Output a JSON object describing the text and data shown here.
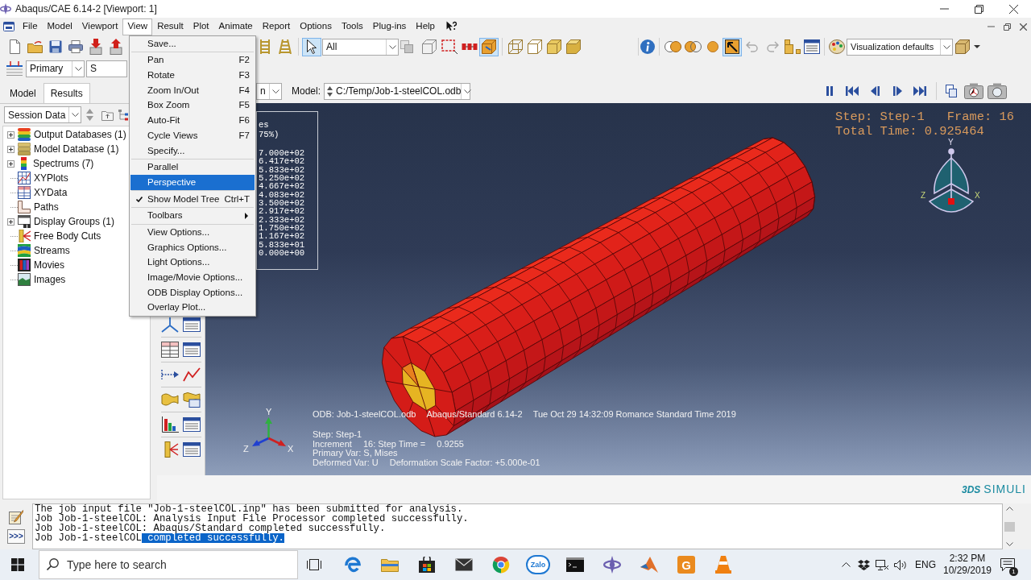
{
  "window": {
    "title": "Abaqus/CAE 6.14-2 [Viewport: 1]"
  },
  "menu_bar": [
    {
      "label": "File",
      "selected": false
    },
    {
      "label": "Model",
      "selected": false
    },
    {
      "label": "Viewport",
      "selected": false
    },
    {
      "label": "View",
      "selected": true
    },
    {
      "label": "Result",
      "selected": false
    },
    {
      "label": "Plot",
      "selected": false
    },
    {
      "label": "Animate",
      "selected": false
    },
    {
      "label": "Report",
      "selected": false
    },
    {
      "label": "Options",
      "selected": false
    },
    {
      "label": "Tools",
      "selected": false
    },
    {
      "label": "Plug-ins",
      "selected": false
    },
    {
      "label": "Help",
      "selected": false
    }
  ],
  "view_menu": [
    {
      "kind": "item",
      "label": "Save...",
      "selected": false,
      "checked": false
    },
    {
      "kind": "separator"
    },
    {
      "kind": "item",
      "label": "Pan",
      "shortcut": "F2",
      "selected": false,
      "checked": false
    },
    {
      "kind": "item",
      "label": "Rotate",
      "shortcut": "F3",
      "selected": false,
      "checked": false
    },
    {
      "kind": "item",
      "label": "Zoom In/Out",
      "shortcut": "F4",
      "selected": false,
      "checked": false
    },
    {
      "kind": "item",
      "label": "Box Zoom",
      "shortcut": "F5",
      "selected": false,
      "checked": false
    },
    {
      "kind": "item",
      "label": "Auto-Fit",
      "shortcut": "F6",
      "selected": false,
      "checked": false
    },
    {
      "kind": "item",
      "label": "Cycle Views",
      "shortcut": "F7",
      "selected": false,
      "checked": false
    },
    {
      "kind": "item",
      "label": "Specify...",
      "selected": false,
      "checked": false
    },
    {
      "kind": "separator"
    },
    {
      "kind": "item",
      "label": "Parallel",
      "selected": false,
      "checked": false
    },
    {
      "kind": "item",
      "label": "Perspective",
      "selected": true,
      "checked": false
    },
    {
      "kind": "separator"
    },
    {
      "kind": "item",
      "label": "Show Model Tree",
      "shortcut": "Ctrl+T",
      "selected": false,
      "checked": true
    },
    {
      "kind": "separator"
    },
    {
      "kind": "submenu",
      "label": "Toolbars",
      "selected": false,
      "checked": false
    },
    {
      "kind": "separator"
    },
    {
      "kind": "item",
      "label": "View Options...",
      "selected": false,
      "checked": false
    },
    {
      "kind": "item",
      "label": "Graphics Options...",
      "selected": false,
      "checked": false
    },
    {
      "kind": "item",
      "label": "Light Options...",
      "selected": false,
      "checked": false
    },
    {
      "kind": "item",
      "label": "Image/Movie Options...",
      "selected": false,
      "checked": false
    },
    {
      "kind": "item",
      "label": "ODB Display Options...",
      "selected": false,
      "checked": false
    },
    {
      "kind": "item",
      "label": "Overlay Plot...",
      "selected": false,
      "checked": false
    }
  ],
  "toolbar": {
    "pointer_selected": true,
    "selection_filter": "All",
    "box_view_selected": true,
    "arrow_view_selected": true,
    "display_options": "Visualization defaults",
    "field_position": "Primary",
    "field_variable": "S"
  },
  "context_bar": {
    "step_value": "n",
    "model_label": "Model:",
    "model_value": "C:/Temp/Job-1-steelCOL.odb"
  },
  "tree_tabs": [
    {
      "label": "Model",
      "selected": false
    },
    {
      "label": "Results",
      "selected": true
    }
  ],
  "tree_source": "Session Data",
  "tree": [
    {
      "kind": "group",
      "label": "Output Databases (1)",
      "expanded": false
    },
    {
      "kind": "group",
      "label": "Model Database (1)",
      "expanded": false
    },
    {
      "kind": "group",
      "label": "Spectrums (7)",
      "expanded": false
    },
    {
      "kind": "leaf",
      "label": "XYPlots"
    },
    {
      "kind": "leaf",
      "label": "XYData"
    },
    {
      "kind": "leaf",
      "label": "Paths"
    },
    {
      "kind": "group",
      "label": "Display Groups (1)",
      "expanded": false
    },
    {
      "kind": "leaf",
      "label": "Free Body Cuts"
    },
    {
      "kind": "leaf",
      "label": "Streams"
    },
    {
      "kind": "leaf",
      "label": "Movies"
    },
    {
      "kind": "leaf",
      "label": "Images"
    }
  ],
  "viewport": {
    "legend": {
      "title_fragments": [
        "es",
        "75%)"
      ],
      "values": [
        "7.000e+02",
        "6.417e+02",
        "5.833e+02",
        "5.250e+02",
        "4.667e+02",
        "4.083e+02",
        "3.500e+02",
        "2.917e+02",
        "2.333e+02",
        "1.750e+02",
        "1.167e+02",
        "5.833e+01",
        "0.000e+00"
      ]
    },
    "status": [
      [
        "Step: Step-1",
        "Frame: 16"
      ],
      [
        "Total Time: 0.925464"
      ]
    ],
    "view_cube": {
      "y_label": "Y",
      "z_label": "Z",
      "x_label": "X"
    },
    "title_block": [
      "ODB: Job-1-steelCOL.odb",
      "Abaqus/Standard 6.14-2",
      "Tue Oct 29 14:32:09 Romance Standard Time 2019"
    ],
    "info_lines": [
      [
        "Step: Step-1"
      ],
      [
        "Increment",
        "16: Step Time =",
        "0.9255"
      ],
      [
        "Primary Var: S, Mises"
      ],
      [
        "Deformed Var: U",
        "Deformation Scale Factor: +5.000e-01"
      ]
    ],
    "axis_triad": {
      "y_label": "Y",
      "z_label": "Z",
      "x_label": "X"
    }
  },
  "logo": {
    "mark": "3DS",
    "text": "SIMULI"
  },
  "message_area": {
    "command_button": ">>>",
    "lines": [
      [
        {
          "text": "The job input file \"Job-1-steelCOL.inp\" has been submitted for analysis.",
          "selected": false
        }
      ],
      [
        {
          "text": "Job Job-1-steelCOL: Analysis Input File Processor completed successfully.",
          "selected": false
        }
      ],
      [
        {
          "text": "Job Job-1-steelCOL: Abaqus/Standard completed successfully.",
          "selected": false
        }
      ],
      [
        {
          "text": "Job Job-1-steelCOL",
          "selected": false
        },
        {
          "text": " completed successfully.",
          "selected": true
        }
      ]
    ]
  },
  "taskbar": {
    "search": {
      "placeholder": "Type here to search"
    },
    "chat_app_label": "Zalo",
    "tile_app_label": "G",
    "language": "ENG",
    "time": "2:32 PM",
    "date": "10/29/2019",
    "notification_count": "1"
  }
}
